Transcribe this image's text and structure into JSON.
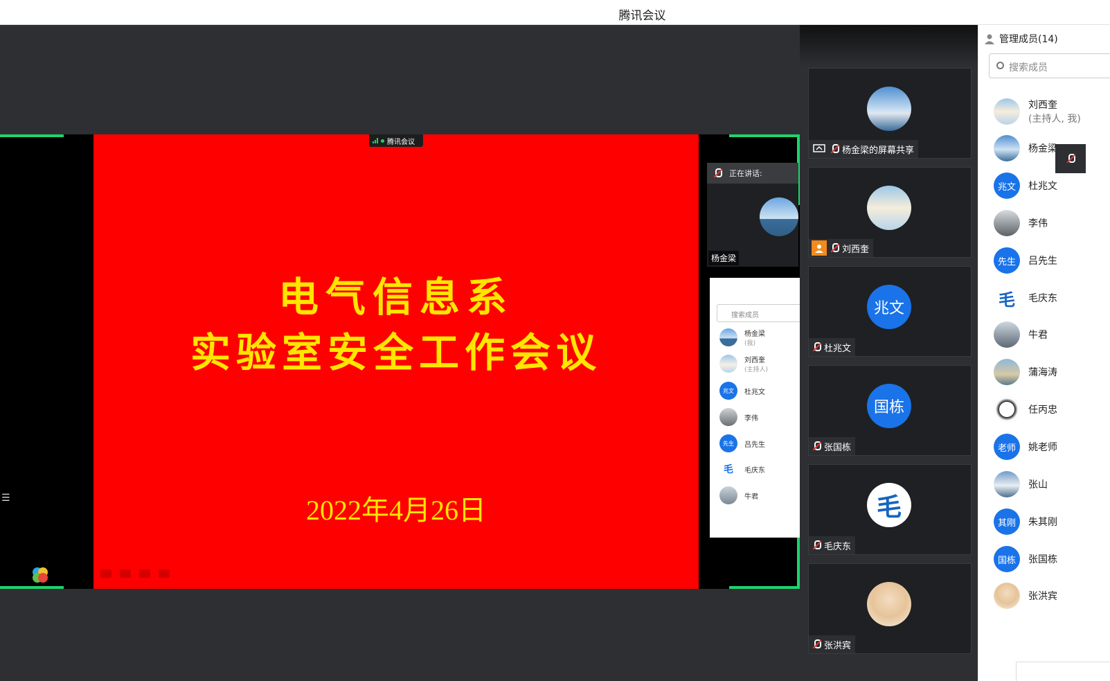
{
  "window": {
    "title": "腾讯会议"
  },
  "slide": {
    "line1": "电气信息系",
    "line2": "实验室安全工作会议",
    "date": "2022年4月26日"
  },
  "share_banner": {
    "label": "腾讯会议"
  },
  "speaking": {
    "label": "正在讲话:",
    "name": "杨金梁"
  },
  "mini_members": {
    "search_placeholder": "搜索成员",
    "items": [
      {
        "name": "杨金梁",
        "sub": "(我)"
      },
      {
        "name": "刘西奎",
        "sub": "(主持人)"
      },
      {
        "name": "杜兆文",
        "avatar": "兆文"
      },
      {
        "name": "李伟"
      },
      {
        "name": "吕先生",
        "avatar": "先生"
      },
      {
        "name": "毛庆东",
        "avatar": "毛"
      },
      {
        "name": "牛君"
      }
    ]
  },
  "video_tiles": [
    {
      "name": "杨金梁的屏幕共享",
      "icon": "screen-share-icon"
    },
    {
      "name": "刘西奎",
      "icon": "user-icon"
    },
    {
      "name": "杜兆文",
      "avatar_text": "兆文"
    },
    {
      "name": "张国栋",
      "avatar_text": "国栋"
    },
    {
      "name": "毛庆东",
      "avatar_text": "毛"
    },
    {
      "name": "张洪宾"
    }
  ],
  "members_panel": {
    "title": "管理成员(14)",
    "search_placeholder": "搜索成员",
    "items": [
      {
        "name": "刘西奎",
        "sub": "(主持人, 我)"
      },
      {
        "name": "杨金梁"
      },
      {
        "name": "杜兆文",
        "avatar_text": "兆文"
      },
      {
        "name": "李伟"
      },
      {
        "name": "吕先生",
        "avatar_text": "先生"
      },
      {
        "name": "毛庆东",
        "avatar_text": "毛"
      },
      {
        "name": "牛君"
      },
      {
        "name": "蒲海涛"
      },
      {
        "name": "任丙忠"
      },
      {
        "name": "姚老师",
        "avatar_text": "老师"
      },
      {
        "name": "张山"
      },
      {
        "name": "朱其刚",
        "avatar_text": "其刚"
      },
      {
        "name": "张国栋",
        "avatar_text": "国栋"
      },
      {
        "name": "张洪宾"
      }
    ]
  },
  "colors": {
    "accent_green": "#1ed36e",
    "avatar_blue": "#1a73e8",
    "slide_red": "#fe0000",
    "slide_text": "#ffe600"
  }
}
